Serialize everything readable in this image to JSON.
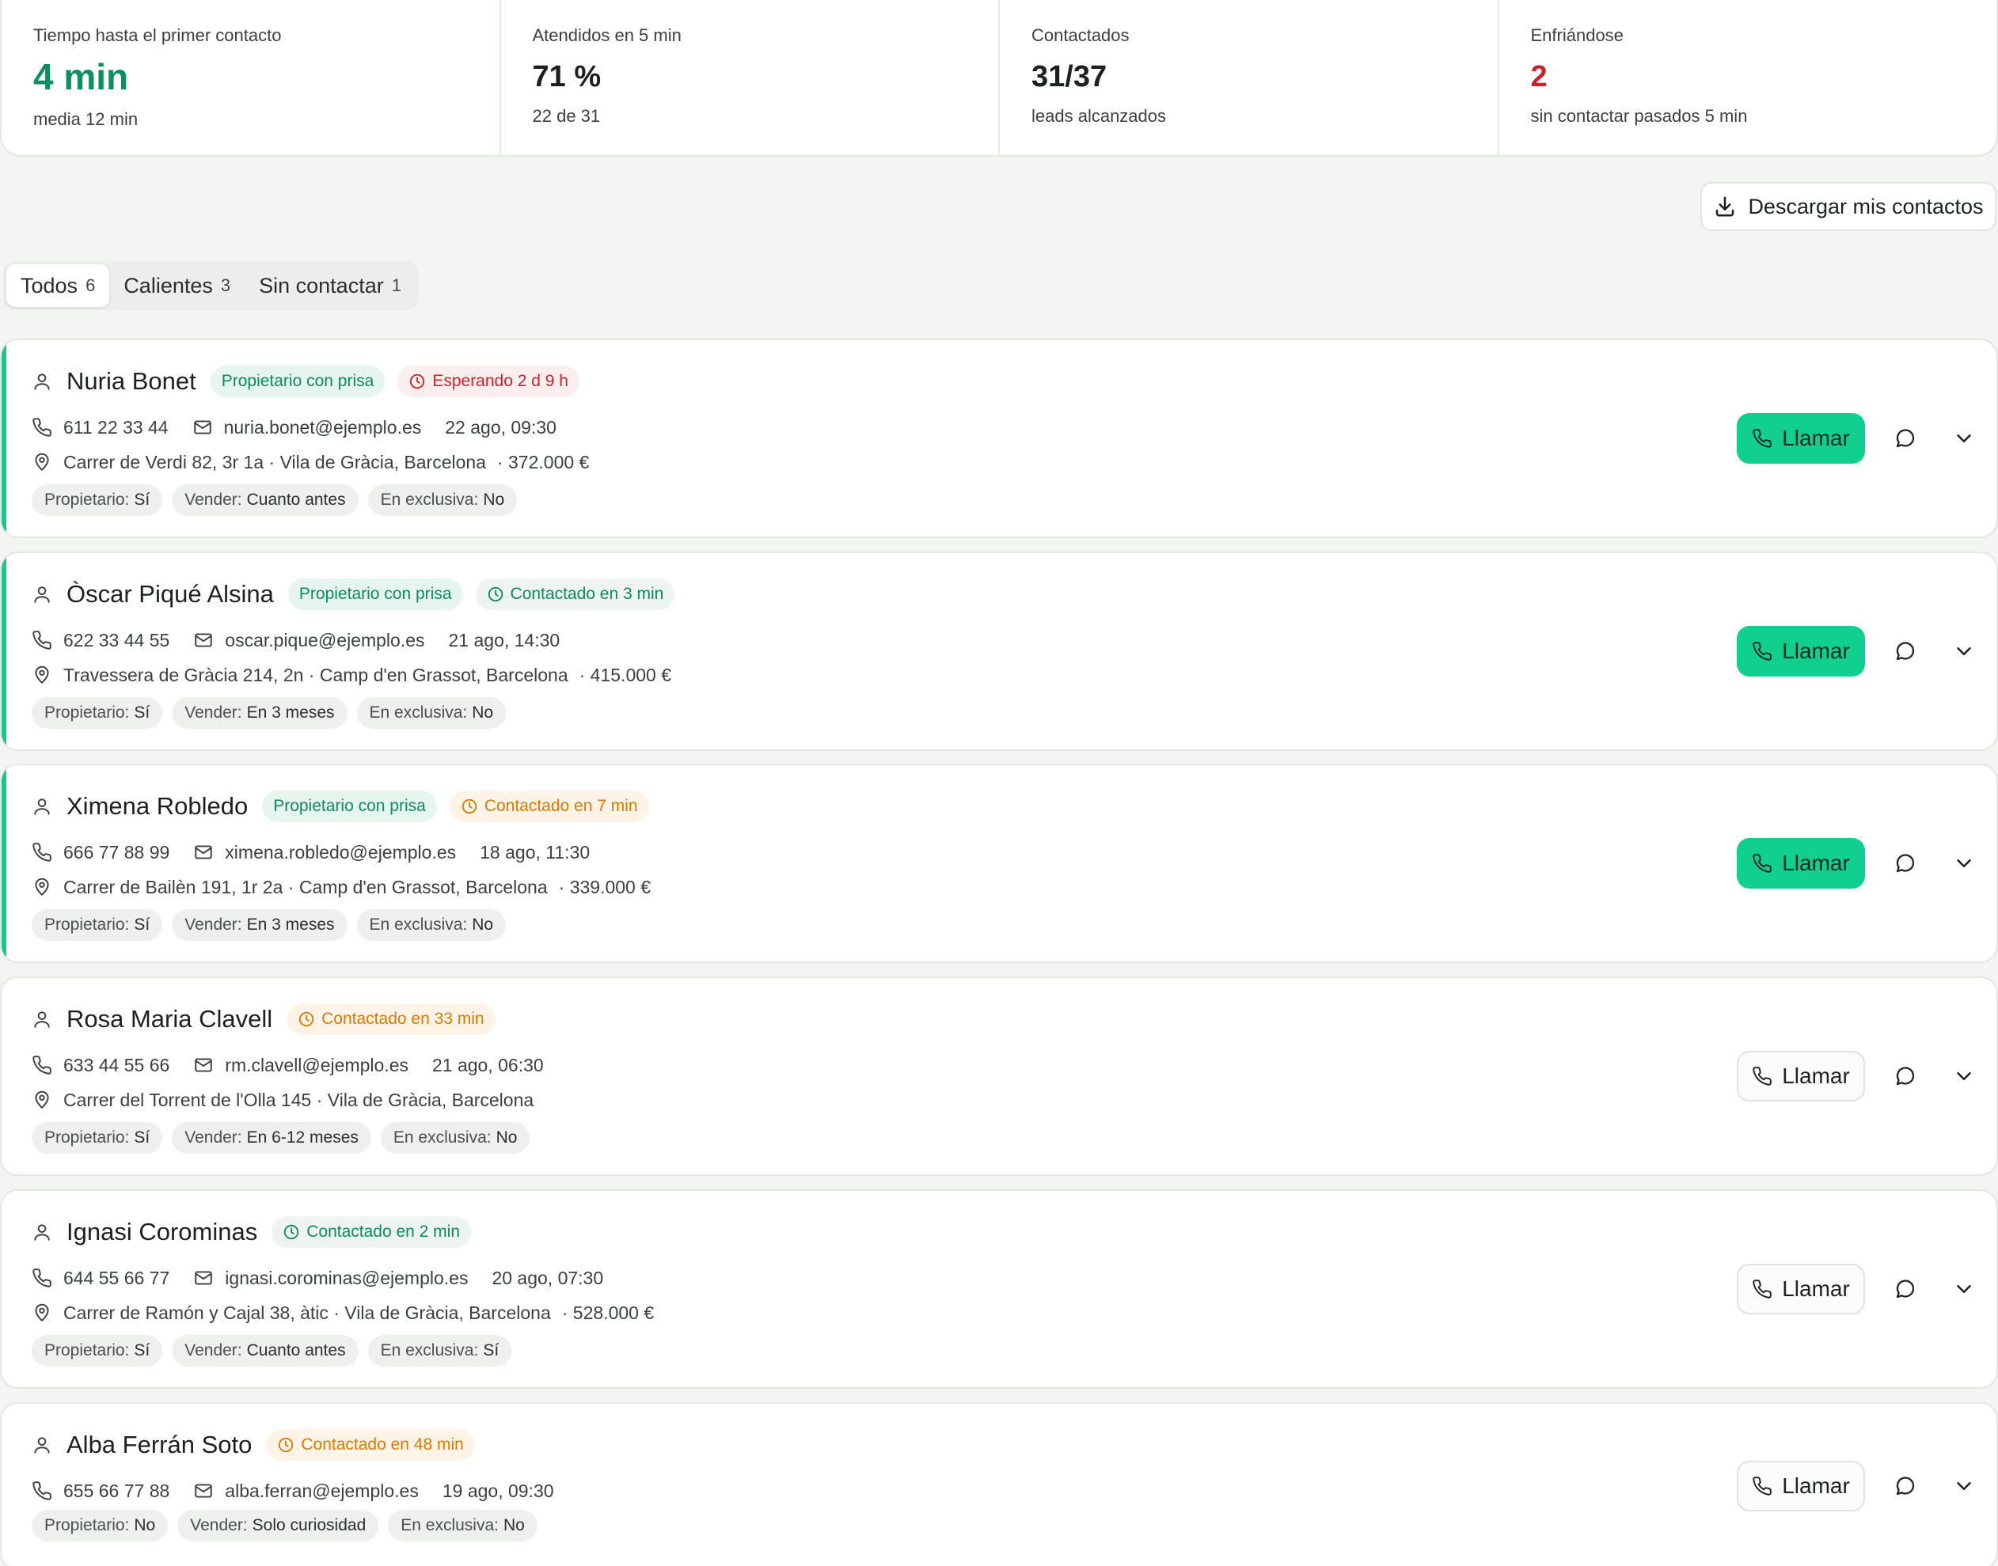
{
  "stats": [
    {
      "label": "Tiempo hasta el primer contacto",
      "value": "4 min",
      "sub": "media 12 min",
      "color": "#0d8f5f"
    },
    {
      "label": "Atendidos en 5 min",
      "value": "71 %",
      "sub": "22 de 31",
      "color": "#1c211e"
    },
    {
      "label": "Contactados",
      "value": "31/37",
      "sub": "leads alcanzados",
      "color": "#1c211e"
    },
    {
      "label": "Enfriándose",
      "value": "2",
      "sub": "sin contactar pasados 5 min",
      "color": "#d01f28"
    }
  ],
  "download": {
    "label": "Descargar mis contactos",
    "icon": "download-icon"
  },
  "tabs": [
    {
      "label": "Todos",
      "count": "6",
      "active": true
    },
    {
      "label": "Calientes",
      "count": "3",
      "active": false
    },
    {
      "label": "Sin contactar",
      "count": "1",
      "active": false
    }
  ],
  "leads": [
    {
      "name": "Nuria Bonet",
      "tag": "Propietario con prisa",
      "status": "Esperando 2 d 9 h",
      "status_color": "red",
      "phone": "611 22 33 44",
      "email": "nuria.bonet@ejemplo.es",
      "date": "22 ago, 09:30",
      "address": "Carrer de Verdi 82, 3r 1a · Vila de Gràcia, Barcelona",
      "price": "· 372.000 €",
      "chips": [
        [
          "Propietario:",
          "Sí"
        ],
        [
          "Vender:",
          "Cuanto antes"
        ],
        [
          "En exclusiva:",
          "No"
        ]
      ],
      "call_label": "Llamar",
      "primary": true
    },
    {
      "name": "Òscar Piqué Alsina",
      "tag": "Propietario con prisa",
      "status": "Contactado en 3 min",
      "status_color": "green",
      "phone": "622 33 44 55",
      "email": "oscar.pique@ejemplo.es",
      "date": "21 ago, 14:30",
      "address": "Travessera de Gràcia 214, 2n · Camp d'en Grassot, Barcelona",
      "price": "· 415.000 €",
      "chips": [
        [
          "Propietario:",
          "Sí"
        ],
        [
          "Vender:",
          "En 3 meses"
        ],
        [
          "En exclusiva:",
          "No"
        ]
      ],
      "call_label": "Llamar",
      "primary": true
    },
    {
      "name": "Ximena Robledo",
      "tag": "Propietario con prisa",
      "status": "Contactado en 7 min",
      "status_color": "orange",
      "phone": "666 77 88 99",
      "email": "ximena.robledo@ejemplo.es",
      "date": "18 ago, 11:30",
      "address": "Carrer de Bailèn 191, 1r 2a · Camp d'en Grassot, Barcelona",
      "price": "· 339.000 €",
      "chips": [
        [
          "Propietario:",
          "Sí"
        ],
        [
          "Vender:",
          "En 3 meses"
        ],
        [
          "En exclusiva:",
          "No"
        ]
      ],
      "call_label": "Llamar",
      "primary": true
    },
    {
      "name": "Rosa Maria Clavell",
      "tag": "",
      "status": "Contactado en 33 min",
      "status_color": "orange",
      "phone": "633 44 55 66",
      "email": "rm.clavell@ejemplo.es",
      "date": "21 ago, 06:30",
      "address": "Carrer del Torrent de l'Olla 145 · Vila de Gràcia, Barcelona",
      "price": "",
      "chips": [
        [
          "Propietario:",
          "Sí"
        ],
        [
          "Vender:",
          "En 6-12 meses"
        ],
        [
          "En exclusiva:",
          "No"
        ]
      ],
      "call_label": "Llamar",
      "primary": false
    },
    {
      "name": "Ignasi Corominas",
      "tag": "",
      "status": "Contactado en 2 min",
      "status_color": "green",
      "phone": "644 55 66 77",
      "email": "ignasi.corominas@ejemplo.es",
      "date": "20 ago, 07:30",
      "address": "Carrer de Ramón y Cajal 38, àtic · Vila de Gràcia, Barcelona",
      "price": "· 528.000 €",
      "chips": [
        [
          "Propietario:",
          "Sí"
        ],
        [
          "Vender:",
          "Cuanto antes"
        ],
        [
          "En exclusiva:",
          "Sí"
        ]
      ],
      "call_label": "Llamar",
      "primary": false
    },
    {
      "name": "Alba Ferrán Soto",
      "tag": "",
      "status": "Contactado en 48 min",
      "status_color": "orange",
      "phone": "655 66 77 88",
      "email": "alba.ferran@ejemplo.es",
      "date": "19 ago, 09:30",
      "address": "",
      "price": "",
      "chips": [
        [
          "Propietario:",
          "No"
        ],
        [
          "Vender:",
          "Solo curiosidad"
        ],
        [
          "En exclusiva:",
          "No"
        ]
      ],
      "call_label": "Llamar",
      "primary": false
    }
  ],
  "colors": {
    "accent": "#11cf8e",
    "green_text": "#0d8a5e",
    "red_text": "#d01f28",
    "orange_text": "#dc7a00"
  }
}
